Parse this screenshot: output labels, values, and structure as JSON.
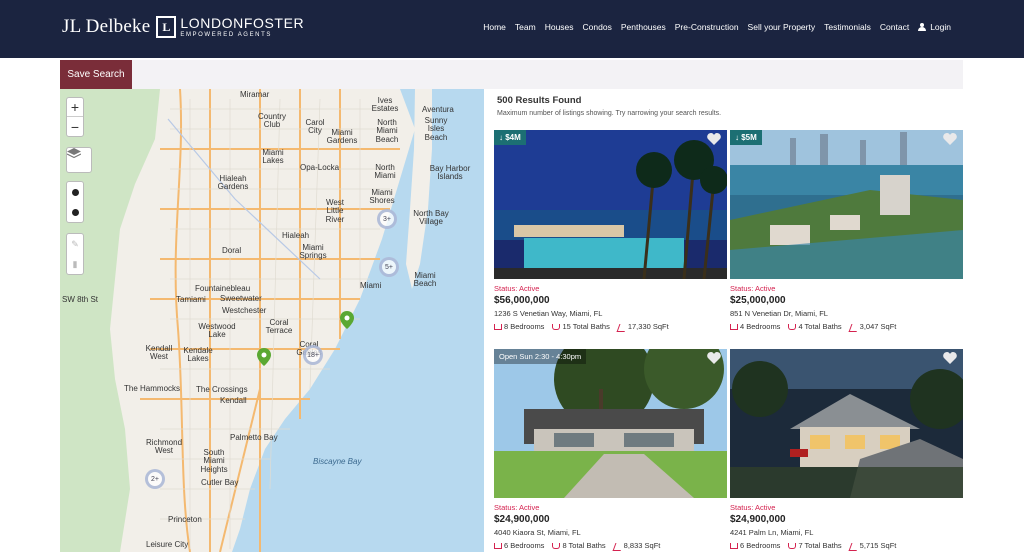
{
  "header": {
    "brand_name": "JL Delbeke",
    "brand_mark": "L",
    "brand_partner": "LONDONFOSTER",
    "brand_tagline": "EMPOWERED AGENTS",
    "nav": [
      "Home",
      "Team",
      "Houses",
      "Condos",
      "Penthouses",
      "Pre-Construction",
      "Sell your Property",
      "Testimonials",
      "Contact"
    ],
    "login_label": "Login"
  },
  "toolbar": {
    "save_label": "Save Search"
  },
  "map": {
    "labels": [
      "Miramar",
      "Country Club",
      "Carol City",
      "Ives Estates",
      "Aventura",
      "Miami Gardens",
      "North Miami Beach",
      "Sunny Isles Beach",
      "Miami Lakes",
      "Opa-Locka",
      "Bay Harbor Islands",
      "Hialeah Gardens",
      "North Miami",
      "Miami Shores",
      "North Bay Village",
      "West Little River",
      "Hialeah",
      "Doral",
      "Miami Springs",
      "Miami Beach",
      "Miami",
      "Fountainebleau",
      "Tamiami",
      "Sweetwater",
      "Westchester",
      "Coral Terrace",
      "Westwood Lake",
      "Kendall West",
      "Kendale Lakes",
      "Coral Gables",
      "The Hammocks",
      "The Crossings",
      "Kendall",
      "Palmetto Bay",
      "Richmond West",
      "South Miami Heights",
      "Cutler Bay",
      "Biscayne Bay",
      "Princeton",
      "Leisure City",
      "SW 8th St"
    ],
    "clusters": [
      "3+",
      "5+",
      "18+",
      "2+"
    ],
    "zoom_in": "+",
    "zoom_out": "−"
  },
  "results": {
    "title": "500 Results Found",
    "note": "Maximum number of listings showing. Try narrowing your search results."
  },
  "listings": [
    {
      "badge": "$4M",
      "status": "Status: Active",
      "price": "$56,000,000",
      "address": "1236 S Venetian Way, Miami, FL",
      "beds": "8 Bedrooms",
      "baths": "15 Total Baths",
      "sqft": "17,330 SqFt"
    },
    {
      "badge": "$5M",
      "status": "Status: Active",
      "price": "$25,000,000",
      "address": "851 N Venetian Dr, Miami, FL",
      "beds": "4 Bedrooms",
      "baths": "4 Total Baths",
      "sqft": "3,047 SqFt"
    },
    {
      "badge": "Open Sun 2:30 - 4:30pm",
      "status": "Status: Active",
      "price": "$24,900,000",
      "address": "4040 Kiaora St, Miami, FL",
      "beds": "6 Bedrooms",
      "baths": "8 Total Baths",
      "sqft": "8,833 SqFt"
    },
    {
      "badge": "",
      "status": "Status: Active",
      "price": "$24,900,000",
      "address": "4241 Palm Ln, Miami, FL",
      "beds": "6 Bedrooms",
      "baths": "7 Total Baths",
      "sqft": "5,715 SqFt"
    }
  ],
  "colors": {
    "header_bg": "#1b2440",
    "save_button": "#7a2d39",
    "status_pink": "#d4224f",
    "badge_teal": "#1c6f73"
  }
}
